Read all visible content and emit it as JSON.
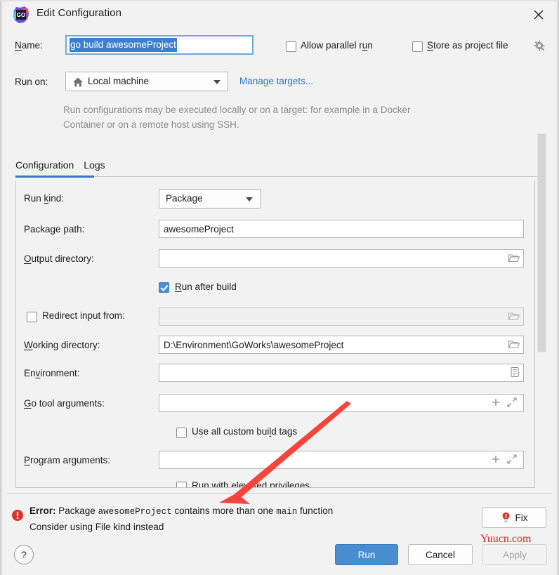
{
  "window": {
    "title": "Edit Configuration",
    "app_icon": "goland-icon",
    "close_icon": "close-icon"
  },
  "name_row": {
    "label": "Name:",
    "value": "go build awesomeProject",
    "allow_parallel_run": {
      "label": "Allow parallel run",
      "checked": false
    },
    "store_as_project_file": {
      "label": "Store as project file",
      "checked": false,
      "gear_icon": "gear-icon"
    }
  },
  "run_on": {
    "label": "Run on:",
    "selected": "Local machine",
    "icon": "home-icon",
    "manage_targets": "Manage targets...",
    "description": "Run configurations may be executed locally or on a target: for example in a Docker Container or on a remote host using SSH."
  },
  "tabs": [
    {
      "label": "Configuration",
      "active": true
    },
    {
      "label": "Logs",
      "active": false
    }
  ],
  "form": {
    "run_kind": {
      "label": "Run kind:",
      "value": "Package"
    },
    "package_path": {
      "label": "Package path:",
      "value": "awesomeProject",
      "placeholder": ""
    },
    "output_directory": {
      "label": "Output directory:",
      "value": "",
      "placeholder": "",
      "icon": "folder-icon"
    },
    "run_after_build": {
      "label": "Run after build",
      "checked": true
    },
    "redirect_input_from": {
      "label": "Redirect input from:",
      "checked": false,
      "value": "",
      "icon": "folder-icon"
    },
    "working_directory": {
      "label": "Working directory:",
      "value": "D:\\Environment\\GoWorks\\awesomeProject",
      "icon": "folder-icon"
    },
    "environment": {
      "label": "Environment:",
      "value": "",
      "icon": "list-icon"
    },
    "go_tool_arguments": {
      "label": "Go tool arguments:",
      "value": "",
      "icons": [
        "plus-icon",
        "expand-icon"
      ]
    },
    "use_all_custom_build_tags": {
      "label": "Use all custom build tags",
      "checked": false
    },
    "program_arguments": {
      "label": "Program arguments:",
      "value": "",
      "icons": [
        "plus-icon",
        "expand-icon"
      ]
    },
    "run_with_elevated_privileges": {
      "label": "Run with elevated privileges",
      "checked": false
    }
  },
  "error": {
    "icon": "error-icon",
    "line1_prefix": "Error:",
    "line1_a": " Package ",
    "line1_mono1": "awesomeProject",
    "line1_b": " contains more than one ",
    "line1_mono2": "main",
    "line1_c": " function",
    "line2": "Consider using File kind instead",
    "fix_button": "Fix",
    "fix_icon": "lightbulb-error-icon"
  },
  "watermark": "Yuucn.com",
  "footer": {
    "help": "?",
    "run": "Run",
    "cancel": "Cancel",
    "apply": "Apply"
  },
  "colors": {
    "accent": "#4a8cd0",
    "link": "#2a70c4",
    "error": "#d8342c",
    "selection": "#3c7fd0",
    "tab_active": "#3b78c3",
    "watermark": "#ee2222"
  }
}
